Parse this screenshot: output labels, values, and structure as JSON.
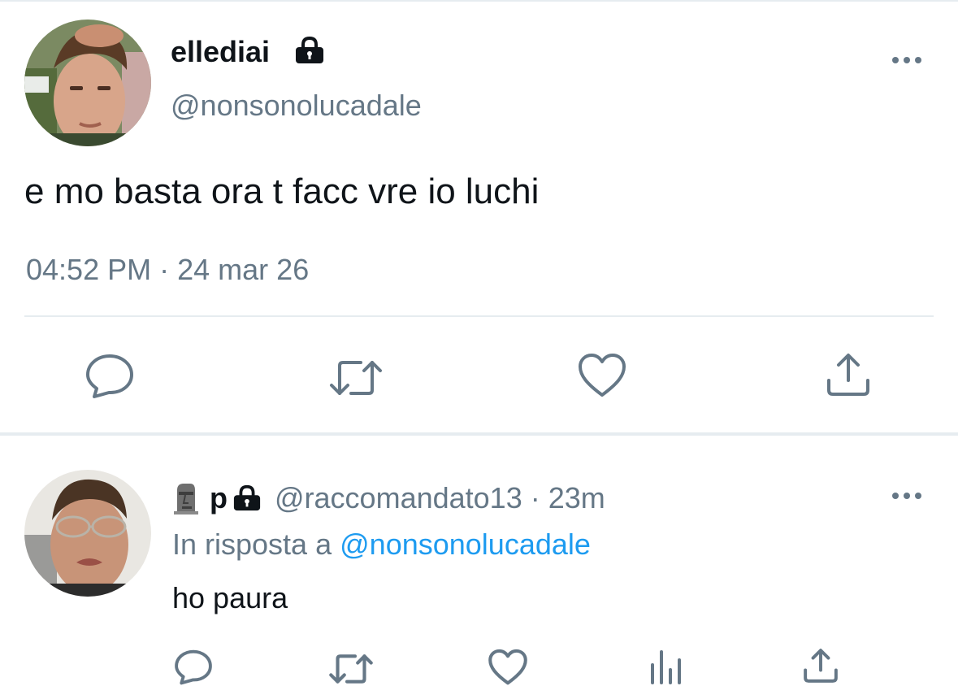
{
  "tweet": {
    "author_name": "ellediai",
    "author_handle": "@nonsonolucadale",
    "text": "e mo basta ora t facc vre io luchi",
    "time": "04:52 PM",
    "separator": "·",
    "date": "24 mar 26",
    "locked": true,
    "actions": [
      "reply-icon",
      "retweet-icon",
      "like-icon",
      "share-icon"
    ]
  },
  "reply": {
    "emoji": "moai",
    "author_name": "p",
    "locked": true,
    "author_handle": "@raccomandato13",
    "separator": "·",
    "age": "23m",
    "in_reply_prefix": "In risposta a",
    "in_reply_handle": "@nonsonolucadale",
    "text": "ho paura",
    "actions": [
      "reply-icon",
      "retweet-icon",
      "like-icon",
      "analytics-icon",
      "share-icon"
    ]
  },
  "colors": {
    "text": "#0f1419",
    "secondary": "#657786",
    "link": "#1d9bf0",
    "divider": "#e6ecf0"
  }
}
